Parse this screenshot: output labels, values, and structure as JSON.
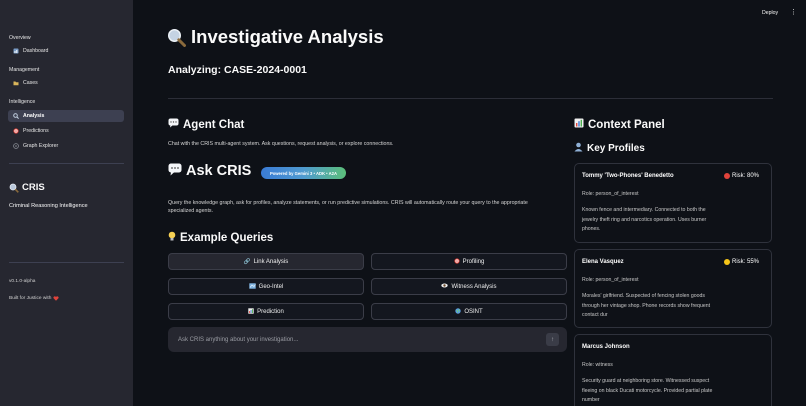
{
  "sidebar": {
    "sections": [
      {
        "title": "Overview",
        "items": [
          {
            "label": "Dashboard",
            "icon": "dashboard-icon"
          }
        ]
      },
      {
        "title": "Management",
        "items": [
          {
            "label": "Cases",
            "icon": "folder-icon"
          }
        ]
      },
      {
        "title": "Intelligence",
        "items": [
          {
            "label": "Analysis",
            "icon": "magnifier-icon",
            "active": true
          },
          {
            "label": "Predictions",
            "icon": "target-icon"
          },
          {
            "label": "Graph Explorer",
            "icon": "network-icon"
          }
        ]
      }
    ],
    "brand": {
      "name": "CRIS",
      "subtitle": "Criminal Reasoning Intelligence"
    },
    "version": "v0.1.0-alpha",
    "footer": "Built for Justice with"
  },
  "topbar": {
    "deploy_label": "Deploy"
  },
  "main": {
    "title": "Investigative Analysis",
    "analyzing": "Analyzing: CASE-2024-0001",
    "agent_chat": {
      "heading": "Agent Chat",
      "description": "Chat with the CRIS multi-agent system. Ask questions, request analysis, or explore connections."
    },
    "ask": {
      "heading": "Ask CRIS",
      "badge": "Powered by Gemini 3 • ADK • A2A",
      "description_line1": "Query the knowledge graph, ask for profiles, analyze statements, or run predictive simulations. CRIS will automatically route your query to the appropriate",
      "description_line2": "specialized agents."
    },
    "examples": {
      "heading": "Example Queries",
      "buttons": [
        {
          "label": "Link Analysis",
          "icon": "link-icon"
        },
        {
          "label": "Profiling",
          "icon": "target-icon"
        },
        {
          "label": "Geo-Intel",
          "icon": "map-icon"
        },
        {
          "label": "Witness Analysis",
          "icon": "eye-icon"
        },
        {
          "label": "Prediction",
          "icon": "chart-icon"
        },
        {
          "label": "OSINT",
          "icon": "globe-icon"
        }
      ]
    },
    "chat_input": {
      "placeholder": "Ask CRIS anything about your investigation..."
    }
  },
  "context": {
    "heading": "Context Panel",
    "profiles_heading": "Key Profiles",
    "profiles": [
      {
        "name": "Tommy 'Two-Phones' Benedetto",
        "risk": "Risk: 80%",
        "risk_color": "#e0433b",
        "role": "Role: person_of_interest",
        "desc": "Known fence and intermediary. Connected to both the jewelry theft ring and narcotics operation. Uses burner phones."
      },
      {
        "name": "Elena Vasquez",
        "risk": "Risk: 55%",
        "risk_color": "#f5c518",
        "role": "Role: person_of_interest",
        "desc": "Morales' girlfriend. Suspected of fencing stolen goods through her vintage shop. Phone records show frequent contact dur"
      },
      {
        "name": "Marcus Johnson",
        "risk": "",
        "risk_color": "",
        "role": "Role: witness",
        "desc": "Security guard at neighboring store. Witnessed suspect fleeing on black Ducati motorcycle. Provided partial plate number"
      }
    ]
  }
}
